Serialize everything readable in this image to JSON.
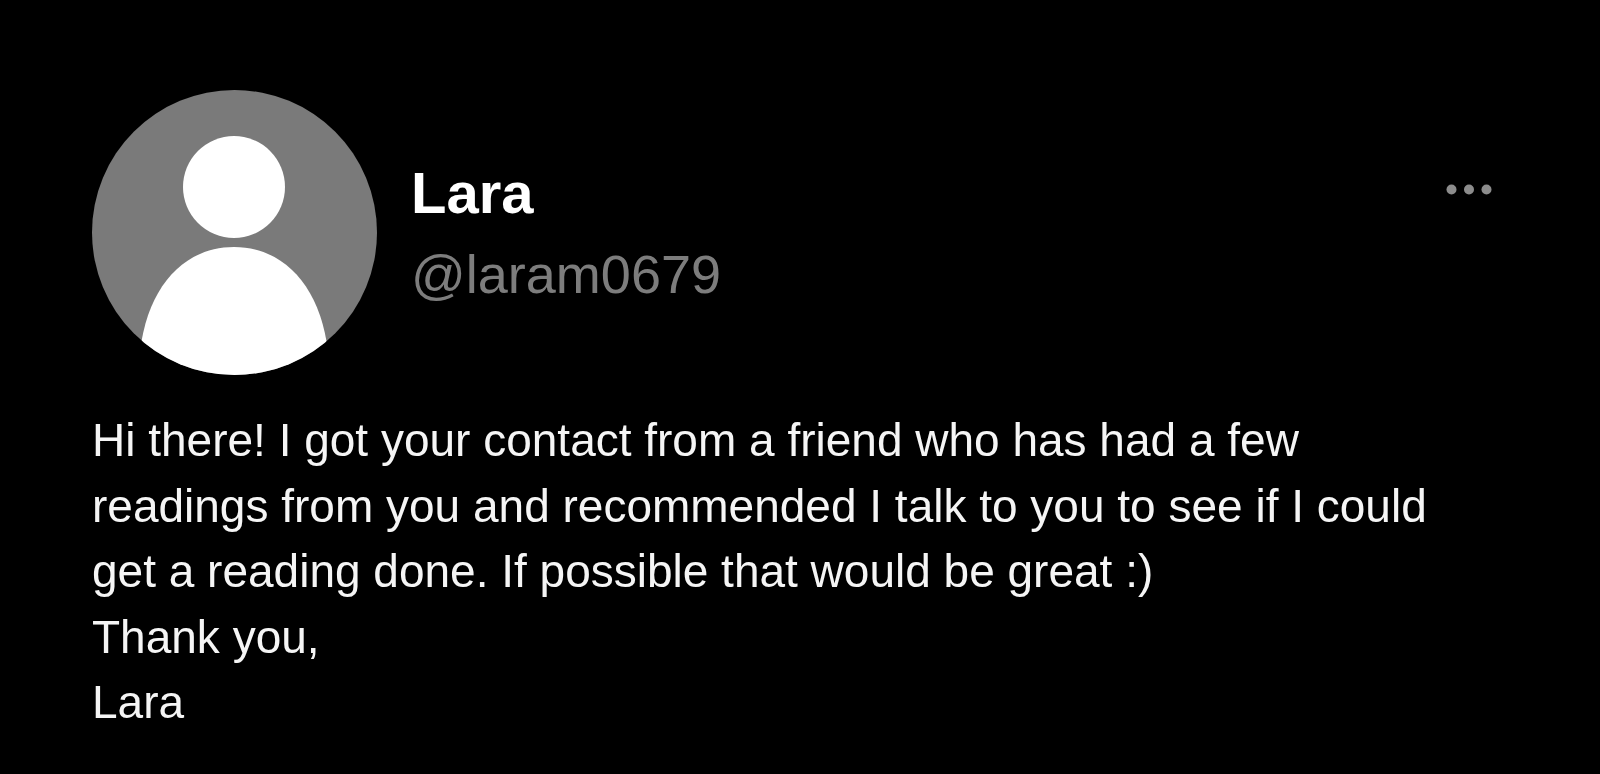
{
  "post": {
    "author": {
      "name": "Lara",
      "handle": "@laram0679"
    },
    "message": [
      "Hi there! I got your contact from a friend who has had a few readings from you and recommended I talk to you to see if I could get a reading done. If possible that would be great :)",
      "Thank you,",
      "Lara"
    ]
  }
}
